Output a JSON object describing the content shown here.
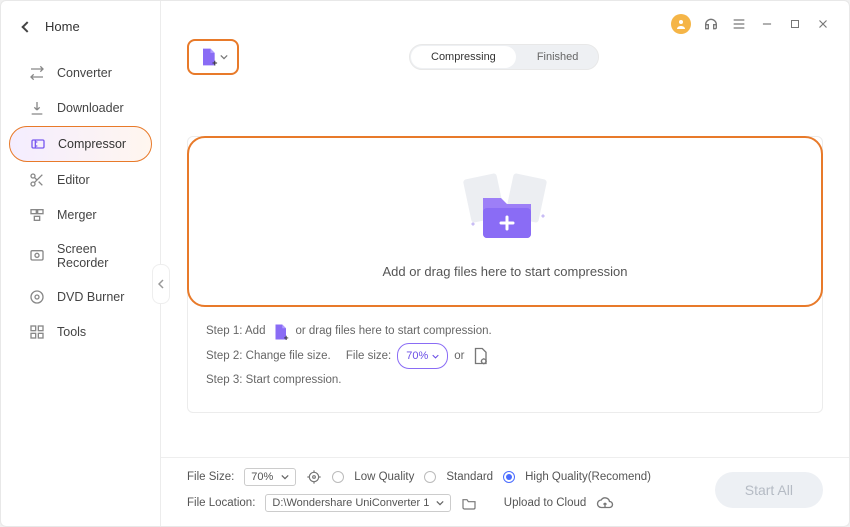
{
  "header": {
    "home": "Home"
  },
  "sidebar": {
    "items": [
      {
        "label": "Converter"
      },
      {
        "label": "Downloader"
      },
      {
        "label": "Compressor"
      },
      {
        "label": "Editor"
      },
      {
        "label": "Merger"
      },
      {
        "label": "Screen Recorder"
      },
      {
        "label": "DVD Burner"
      },
      {
        "label": "Tools"
      }
    ]
  },
  "tabs": {
    "compressing": "Compressing",
    "finished": "Finished"
  },
  "dropzone": {
    "text": "Add or drag files here to start compression"
  },
  "steps": {
    "s1a": "Step 1: Add",
    "s1b": "or drag files here to start compression.",
    "s2a": "Step 2: Change file size.",
    "s2b": "File size:",
    "s2pill": "70%",
    "s2or": "or",
    "s3": "Step 3: Start compression."
  },
  "footer": {
    "filesize_label": "File Size:",
    "filesize_value": "70%",
    "q_low": "Low Quality",
    "q_std": "Standard",
    "q_high": "High Quality(Recomend)",
    "location_label": "File Location:",
    "location_value": "D:\\Wondershare UniConverter 1",
    "upload": "Upload to Cloud",
    "startall": "Start All"
  }
}
